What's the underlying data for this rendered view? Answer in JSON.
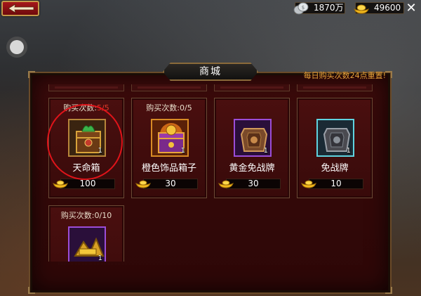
{
  "topbar": {
    "silver_amount": "1870万",
    "gold_amount": "49600",
    "icons": [
      "back-arrow-icon",
      "silver-coin-icon",
      "gold-ingot-icon",
      "close-icon"
    ]
  },
  "shop": {
    "title": "商城",
    "reset_note": "每日购买次数24点重置!",
    "limit_label": "购买次数:",
    "items": [
      {
        "name": "天命箱",
        "bought": "5",
        "max": "5",
        "full": true,
        "qty": "1",
        "price": "100",
        "icon": "fate-chest-icon",
        "frame": "#b7863a"
      },
      {
        "name": "橙色饰品箱子",
        "bought": "0",
        "max": "5",
        "full": false,
        "qty": "1",
        "price": "30",
        "icon": "orange-accessory-chest-icon",
        "frame": "#d88a24"
      },
      {
        "name": "黄金免战牌",
        "bought": "",
        "max": "",
        "full": false,
        "qty": "1",
        "price": "30",
        "icon": "gold-truce-token-icon",
        "frame": "#9b4dd8"
      },
      {
        "name": "免战牌",
        "bought": "",
        "max": "",
        "full": false,
        "qty": "1",
        "price": "10",
        "icon": "truce-token-icon",
        "frame": "#5fd3e0"
      },
      {
        "name": "",
        "bought": "0",
        "max": "10",
        "full": false,
        "qty": "1",
        "price": "",
        "icon": "gold-pile-icon",
        "frame": "#9b4dd8"
      }
    ]
  },
  "colors": {
    "panel_bg": "#3a0a0a",
    "accent_gold": "#e8a23a",
    "limit_full": "#e23a2a",
    "annotation_red": "#e0141a"
  }
}
